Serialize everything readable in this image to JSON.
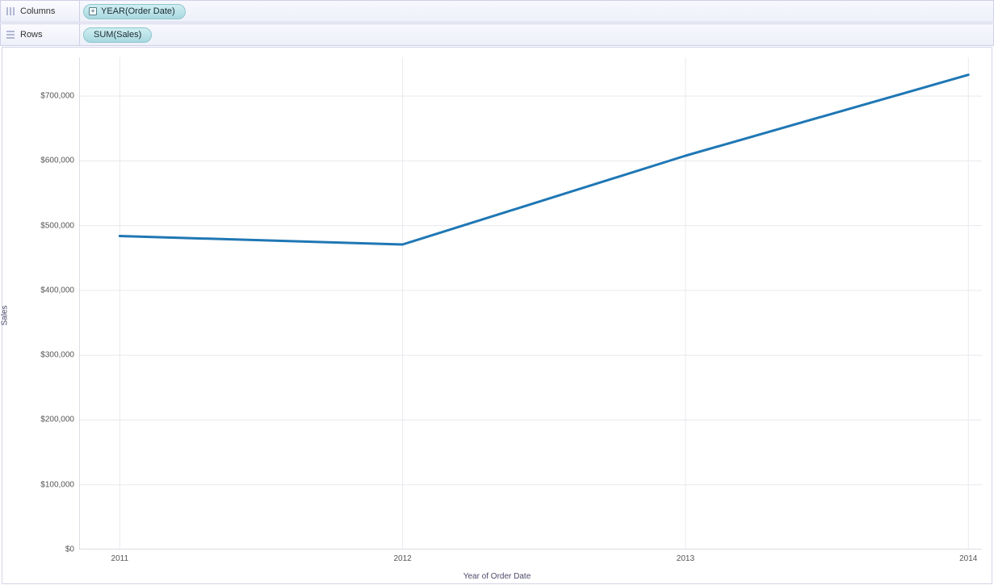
{
  "shelves": {
    "columns": {
      "label": "Columns",
      "pill": "YEAR(Order Date)"
    },
    "rows": {
      "label": "Rows",
      "pill": "SUM(Sales)"
    }
  },
  "axis": {
    "y_title": "Sales",
    "x_title": "Year of Order Date",
    "y_ticks": [
      "$0",
      "$100,000",
      "$200,000",
      "$300,000",
      "$400,000",
      "$500,000",
      "$600,000",
      "$700,000"
    ],
    "x_ticks": [
      "2011",
      "2012",
      "2013",
      "2014"
    ]
  },
  "chart_data": {
    "type": "line",
    "categories": [
      "2011",
      "2012",
      "2013",
      "2014"
    ],
    "values": [
      484000,
      471000,
      608000,
      733000
    ],
    "title": "",
    "xlabel": "Year of Order Date",
    "ylabel": "Sales",
    "ylim": [
      0,
      760000
    ]
  }
}
